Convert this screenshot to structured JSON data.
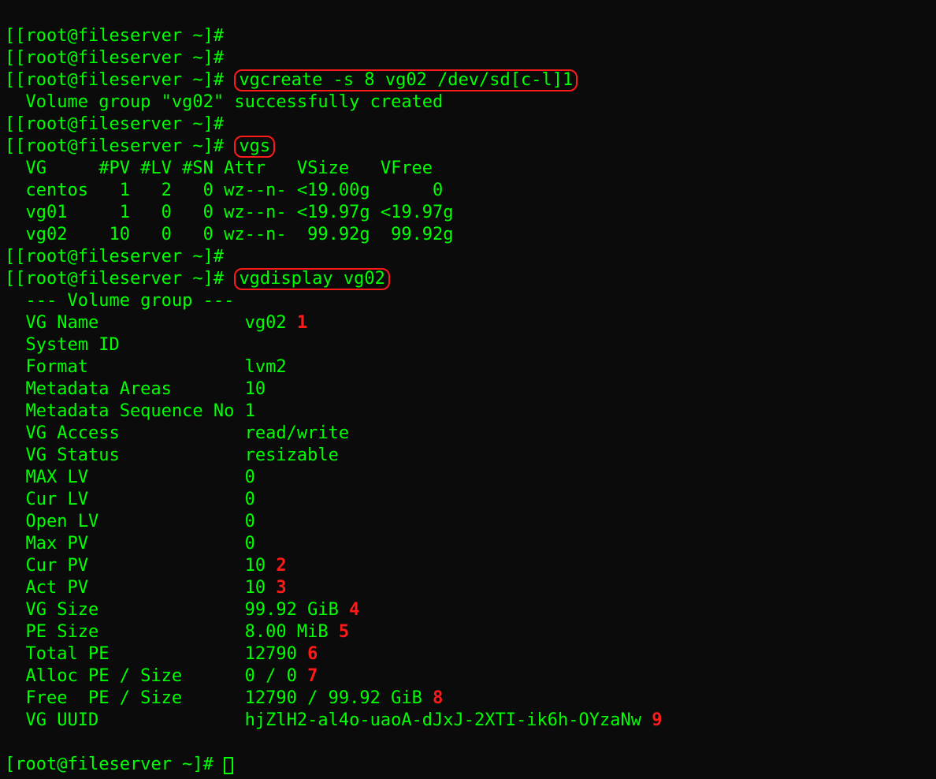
{
  "prompt": "[[root@fileserver ~]#",
  "prompt_single": "[root@fileserver ~]#",
  "cmd_vgcreate": "vgcreate -s 8 vg02 /dev/sd[c-l]1",
  "vgcreate_output": "  Volume group \"vg02\" successfully created",
  "cmd_vgs": "vgs",
  "vgs_header": "  VG     #PV #LV #SN Attr   VSize   VFree",
  "vgs_rows": [
    "  centos   1   2   0 wz--n- <19.00g      0",
    "  vg01     1   0   0 wz--n- <19.97g <19.97g",
    "  vg02    10   0   0 wz--n-  99.92g  99.92g"
  ],
  "cmd_vgdisplay": "vgdisplay vg02",
  "vgdisplay_header": "  --- Volume group ---",
  "vgdisplay": [
    {
      "label": "  VG Name              ",
      "value": "vg02",
      "annot": "1"
    },
    {
      "label": "  System ID            ",
      "value": "",
      "annot": ""
    },
    {
      "label": "  Format               ",
      "value": "lvm2",
      "annot": ""
    },
    {
      "label": "  Metadata Areas       ",
      "value": "10",
      "annot": ""
    },
    {
      "label": "  Metadata Sequence No ",
      "value": "1",
      "annot": ""
    },
    {
      "label": "  VG Access            ",
      "value": "read/write",
      "annot": ""
    },
    {
      "label": "  VG Status            ",
      "value": "resizable",
      "annot": ""
    },
    {
      "label": "  MAX LV               ",
      "value": "0",
      "annot": ""
    },
    {
      "label": "  Cur LV               ",
      "value": "0",
      "annot": ""
    },
    {
      "label": "  Open LV              ",
      "value": "0",
      "annot": ""
    },
    {
      "label": "  Max PV               ",
      "value": "0",
      "annot": ""
    },
    {
      "label": "  Cur PV               ",
      "value": "10",
      "annot": "2"
    },
    {
      "label": "  Act PV               ",
      "value": "10",
      "annot": "3"
    },
    {
      "label": "  VG Size              ",
      "value": "99.92 GiB",
      "annot": "4"
    },
    {
      "label": "  PE Size              ",
      "value": "8.00 MiB",
      "annot": "5"
    },
    {
      "label": "  Total PE             ",
      "value": "12790",
      "annot": "6"
    },
    {
      "label": "  Alloc PE / Size      ",
      "value": "0 / 0",
      "annot": "7"
    },
    {
      "label": "  Free  PE / Size      ",
      "value": "12790 / 99.92 GiB",
      "annot": "8"
    },
    {
      "label": "  VG UUID              ",
      "value": "hjZlH2-al4o-uaoA-dJxJ-2XTI-ik6h-OYzaNw",
      "annot": "9"
    }
  ]
}
